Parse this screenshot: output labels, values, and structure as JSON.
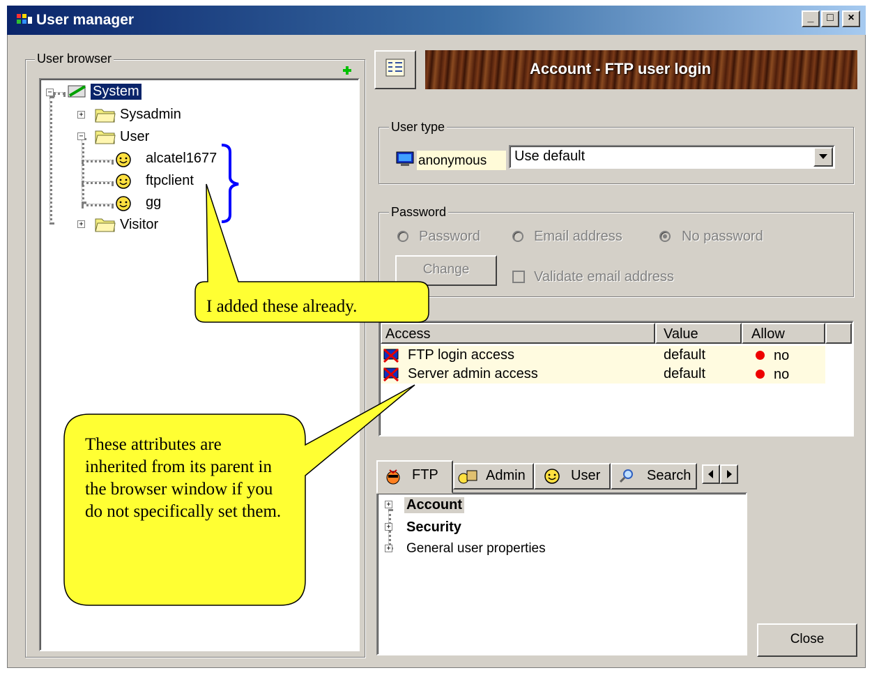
{
  "window": {
    "title": "User manager"
  },
  "titlebar_buttons": {
    "minimize": "_",
    "maximize": "□",
    "close": "×"
  },
  "browser": {
    "group_label": "User browser",
    "tree": {
      "root": "System",
      "nodes": [
        {
          "label": "Sysadmin"
        },
        {
          "label": "User",
          "children": [
            "alcatel1677",
            "ftpclient",
            "gg"
          ]
        },
        {
          "label": "Visitor"
        }
      ]
    }
  },
  "header": {
    "title": "Account - FTP user login"
  },
  "user_type": {
    "group_label": "User type",
    "tag": "anonymous",
    "select_value": "Use default"
  },
  "password": {
    "group_label": "Password",
    "options": [
      "Password",
      "Email address",
      "No password"
    ],
    "selected": "No password",
    "change_button": "Change",
    "validate_label": "Validate email address"
  },
  "access_table": {
    "columns": [
      "Access",
      "Value",
      "Allow"
    ],
    "rows": [
      {
        "access": "FTP login access",
        "value": "default",
        "allow": "no"
      },
      {
        "access": "Server admin access",
        "value": "default",
        "allow": "no"
      }
    ]
  },
  "tabs": [
    "FTP",
    "Admin",
    "User",
    "Search"
  ],
  "prop_tree": [
    "Account",
    "Security",
    "General user properties"
  ],
  "close_button": "Close",
  "callouts": {
    "added": "I added these already.",
    "inherited": "These attributes are inherited from its parent in the browser window if you do not specifically set them."
  },
  "colors": {
    "title_start": "#0a246a",
    "title_end": "#a6caf0",
    "callout_fill": "#ffff33",
    "annotation_brace": "#0000ff",
    "allow_dot": "#ee0000"
  }
}
